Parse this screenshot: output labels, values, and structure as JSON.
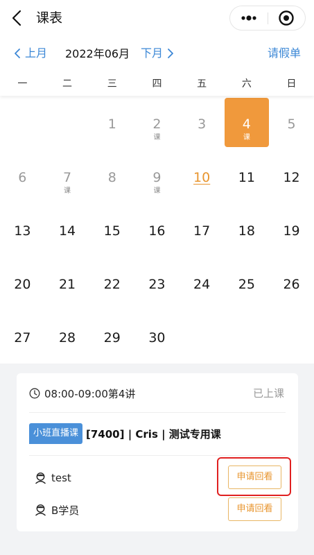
{
  "topbar": {
    "title": "课表",
    "back_icon": "chevron-left-icon",
    "more_icon": "more-dots-icon",
    "close_icon": "record-target-icon"
  },
  "month_nav": {
    "prev_label": "上月",
    "current_month": "2022年06月",
    "next_label": "下月",
    "leave_label": "请假单"
  },
  "weekdays": [
    "一",
    "二",
    "三",
    "四",
    "五",
    "六",
    "日"
  ],
  "calendar": {
    "days": [
      {
        "d": "1",
        "tag": ""
      },
      {
        "d": "2",
        "tag": "课"
      },
      {
        "d": "3",
        "tag": ""
      },
      {
        "d": "4",
        "tag": "课"
      },
      {
        "d": "5",
        "tag": ""
      },
      {
        "d": "6",
        "tag": ""
      },
      {
        "d": "7",
        "tag": "课"
      },
      {
        "d": "8",
        "tag": ""
      },
      {
        "d": "9",
        "tag": "课"
      },
      {
        "d": "10",
        "tag": ""
      },
      {
        "d": "11",
        "tag": ""
      },
      {
        "d": "12",
        "tag": ""
      },
      {
        "d": "13",
        "tag": ""
      },
      {
        "d": "14",
        "tag": ""
      },
      {
        "d": "15",
        "tag": ""
      },
      {
        "d": "16",
        "tag": ""
      },
      {
        "d": "17",
        "tag": ""
      },
      {
        "d": "18",
        "tag": ""
      },
      {
        "d": "19",
        "tag": ""
      },
      {
        "d": "20",
        "tag": ""
      },
      {
        "d": "21",
        "tag": ""
      },
      {
        "d": "22",
        "tag": ""
      },
      {
        "d": "23",
        "tag": ""
      },
      {
        "d": "24",
        "tag": ""
      },
      {
        "d": "25",
        "tag": ""
      },
      {
        "d": "26",
        "tag": ""
      },
      {
        "d": "27",
        "tag": ""
      },
      {
        "d": "28",
        "tag": ""
      },
      {
        "d": "29",
        "tag": ""
      },
      {
        "d": "30",
        "tag": ""
      }
    ],
    "selected_day": "4",
    "today": "10",
    "selected_color": "#f0993c",
    "today_color": "#e8952e"
  },
  "lesson": {
    "time": "08:00-09:00第4讲",
    "status": "已上课",
    "badge": "小班直播课",
    "course_name": "[7400] | Cris | 测试专用课",
    "students": [
      {
        "name": "test",
        "button": "申请回看"
      },
      {
        "name": "B学员",
        "button": "申请回看"
      }
    ]
  },
  "colors": {
    "accent_blue": "#3b87d6",
    "badge_blue": "#4a90d9",
    "button_orange": "#e8952e",
    "highlight_red": "#e02020"
  }
}
